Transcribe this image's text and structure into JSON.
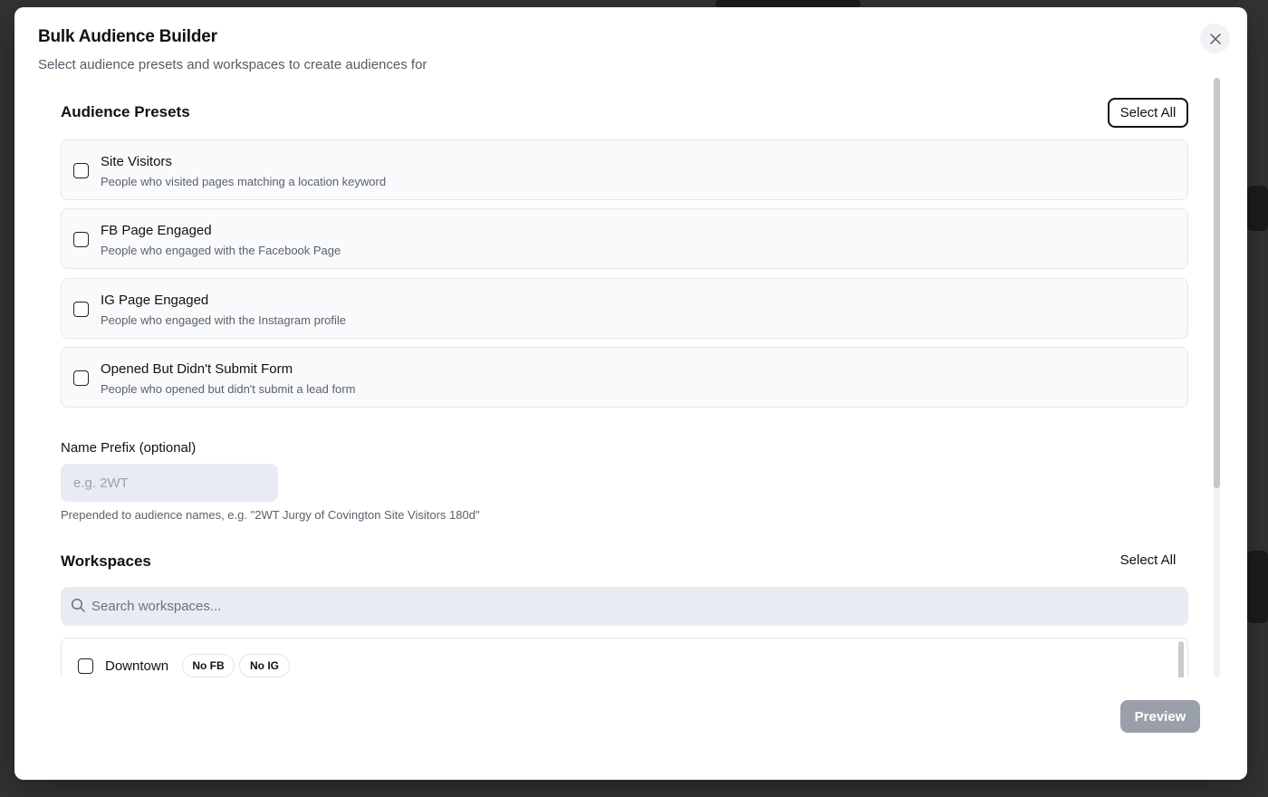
{
  "modal": {
    "title": "Bulk Audience Builder",
    "subtitle": "Select audience presets and workspaces to create audiences for"
  },
  "presets": {
    "title": "Audience Presets",
    "select_all_label": "Select All",
    "items": [
      {
        "name": "Site Visitors",
        "description": "People who visited pages matching a location keyword",
        "checked": false
      },
      {
        "name": "FB Page Engaged",
        "description": "People who engaged with the Facebook Page",
        "checked": false
      },
      {
        "name": "IG Page Engaged",
        "description": "People who engaged with the Instagram profile",
        "checked": false
      },
      {
        "name": "Opened But Didn't Submit Form",
        "description": "People who opened but didn't submit a lead form",
        "checked": false
      }
    ]
  },
  "name_prefix": {
    "label": "Name Prefix (optional)",
    "value": "",
    "placeholder": "e.g. 2WT",
    "helper": "Prepended to audience names, e.g. \"2WT Jurgy of Covington Site Visitors 180d\""
  },
  "workspaces": {
    "title": "Workspaces",
    "select_all_label": "Select All",
    "search_placeholder": "Search workspaces...",
    "search_value": "",
    "items": [
      {
        "name": "Downtown",
        "badges": [
          "No FB",
          "No IG"
        ],
        "checked": false
      }
    ]
  },
  "footer": {
    "preview_label": "Preview"
  },
  "icons": {
    "close": "close-icon",
    "search": "search-icon"
  },
  "colors": {
    "primary_disabled": "#9aa0a9",
    "input_bg": "#e9ebf2",
    "card_bg": "#f9fafb"
  }
}
